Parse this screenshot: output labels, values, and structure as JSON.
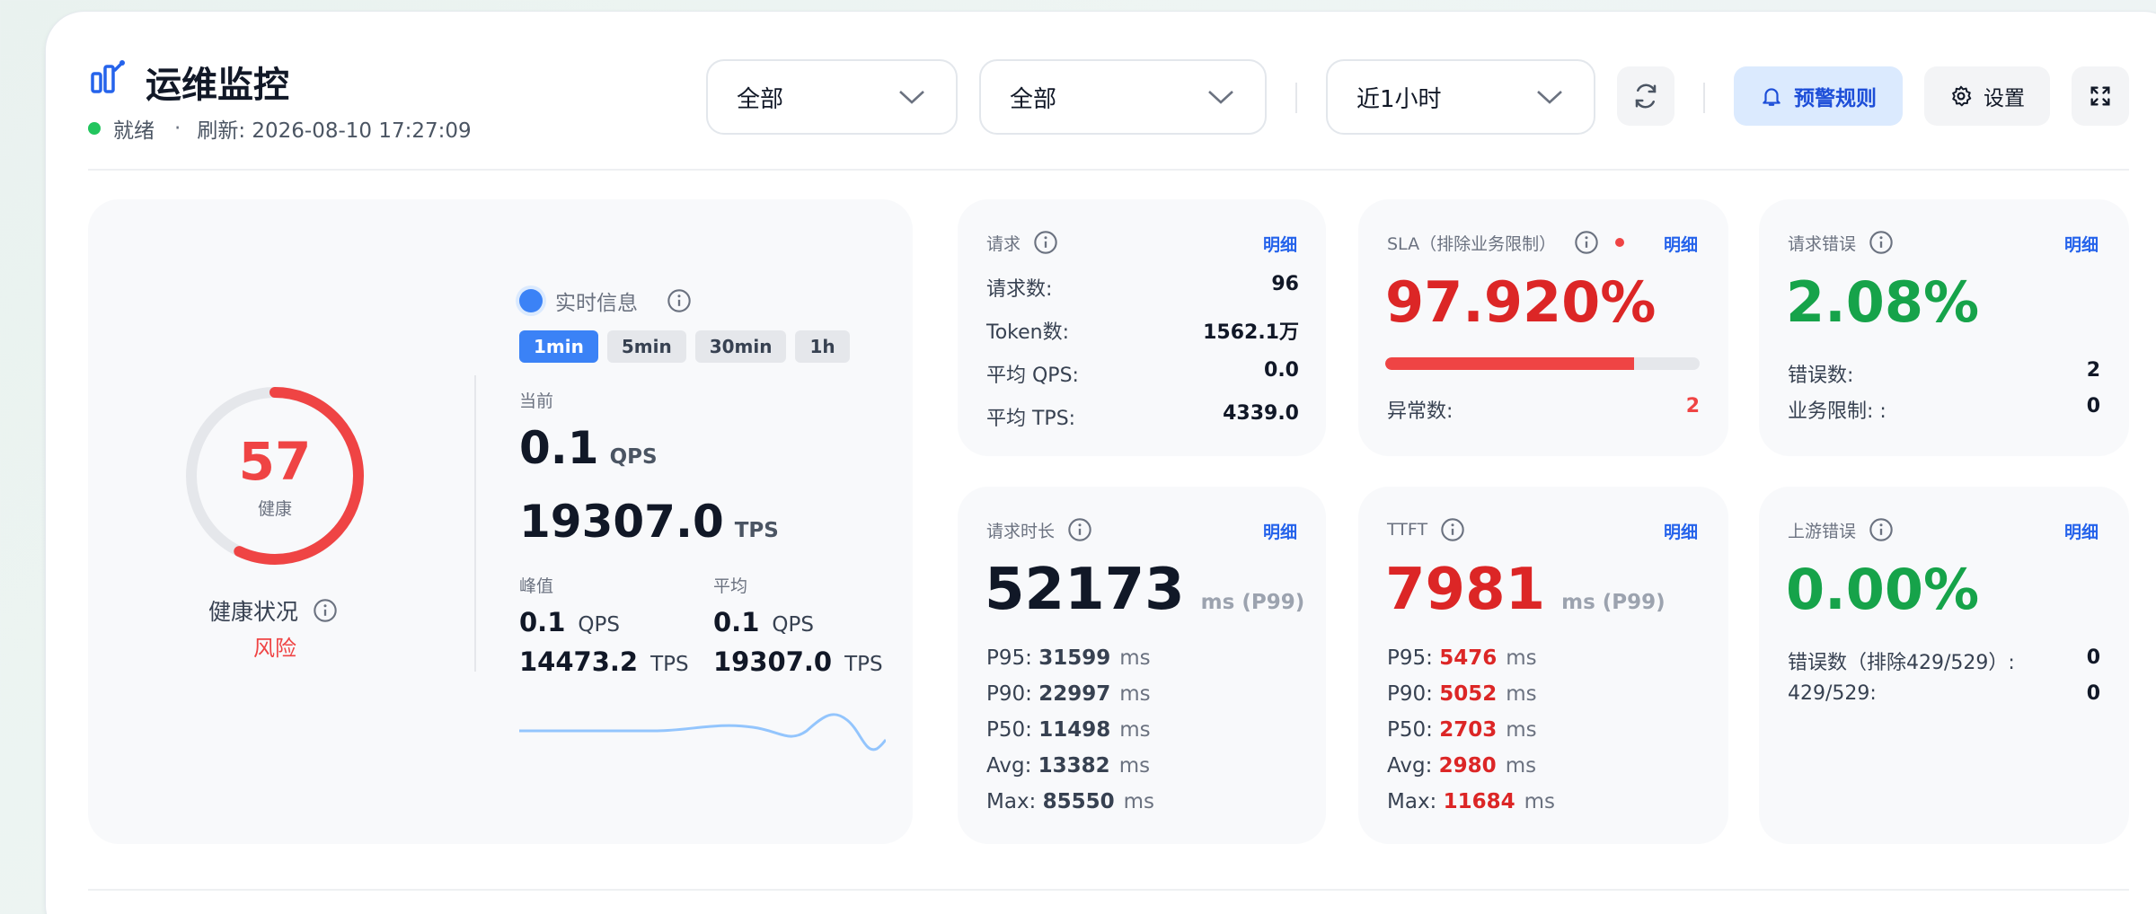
{
  "header": {
    "title": "运维监控",
    "status": "就绪",
    "separator": "·",
    "refresh": "刷新: 2026-08-10 17:27:09",
    "select1": "全部",
    "select2": "全部",
    "time_range": "近1小时",
    "alert_rules": "预警规则",
    "settings": "设置"
  },
  "health": {
    "score": "57",
    "score_label": "健康",
    "score_fraction": 0.57,
    "title": "健康状况",
    "status": "风险"
  },
  "realtime": {
    "title": "实时信息",
    "tabs": [
      "1min",
      "5min",
      "30min",
      "1h"
    ],
    "active_tab": "1min",
    "current_label": "当前",
    "current_qps": "0.1",
    "current_tps": "19307.0",
    "peak_label": "峰值",
    "peak_qps": "0.1",
    "peak_tps": "14473.2",
    "avg_label": "平均",
    "avg_qps": "0.1",
    "avg_tps": "19307.0",
    "qps_unit": "QPS",
    "tps_unit": "TPS"
  },
  "requests": {
    "title": "请求",
    "link": "明细",
    "rows": [
      {
        "label": "请求数:",
        "value": "96"
      },
      {
        "label": "Token数:",
        "value": "1562.1万"
      },
      {
        "label": "平均 QPS:",
        "value": "0.0"
      },
      {
        "label": "平均 TPS:",
        "value": "4339.0"
      }
    ]
  },
  "sla": {
    "title": "SLA（排除业务限制）",
    "link": "明细",
    "value": "97.920%",
    "bar_fraction": 0.79,
    "anomaly_label": "异常数:",
    "anomaly_value": "2"
  },
  "req_errors": {
    "title": "请求错误",
    "link": "明细",
    "value": "2.08%",
    "rows": [
      {
        "label": "错误数:",
        "value": "2"
      },
      {
        "label": "业务限制: :",
        "value": "0"
      }
    ]
  },
  "duration": {
    "title": "请求时长",
    "link": "明细",
    "value": "52173",
    "unit": "ms (P99)",
    "ms": "ms",
    "rows": [
      {
        "label": "P95:",
        "value": "31599"
      },
      {
        "label": "P90:",
        "value": "22997"
      },
      {
        "label": "P50:",
        "value": "11498"
      },
      {
        "label": "Avg:",
        "value": "13382"
      },
      {
        "label": "Max:",
        "value": "85550"
      }
    ]
  },
  "ttft": {
    "title": "TTFT",
    "link": "明细",
    "value": "7981",
    "unit": "ms (P99)",
    "ms": "ms",
    "rows": [
      {
        "label": "P95:",
        "value": "5476"
      },
      {
        "label": "P90:",
        "value": "5052"
      },
      {
        "label": "P50:",
        "value": "2703"
      },
      {
        "label": "Avg:",
        "value": "2980"
      },
      {
        "label": "Max:",
        "value": "11684"
      }
    ]
  },
  "upstream": {
    "title": "上游错误",
    "link": "明细",
    "value": "0.00%",
    "rows": [
      {
        "label": "错误数（排除429/529）:",
        "value": "0"
      },
      {
        "label": "429/529:",
        "value": "0"
      }
    ]
  },
  "colors": {
    "danger": "#ef4444",
    "success": "#16a34a",
    "primary": "#3b82f6"
  }
}
